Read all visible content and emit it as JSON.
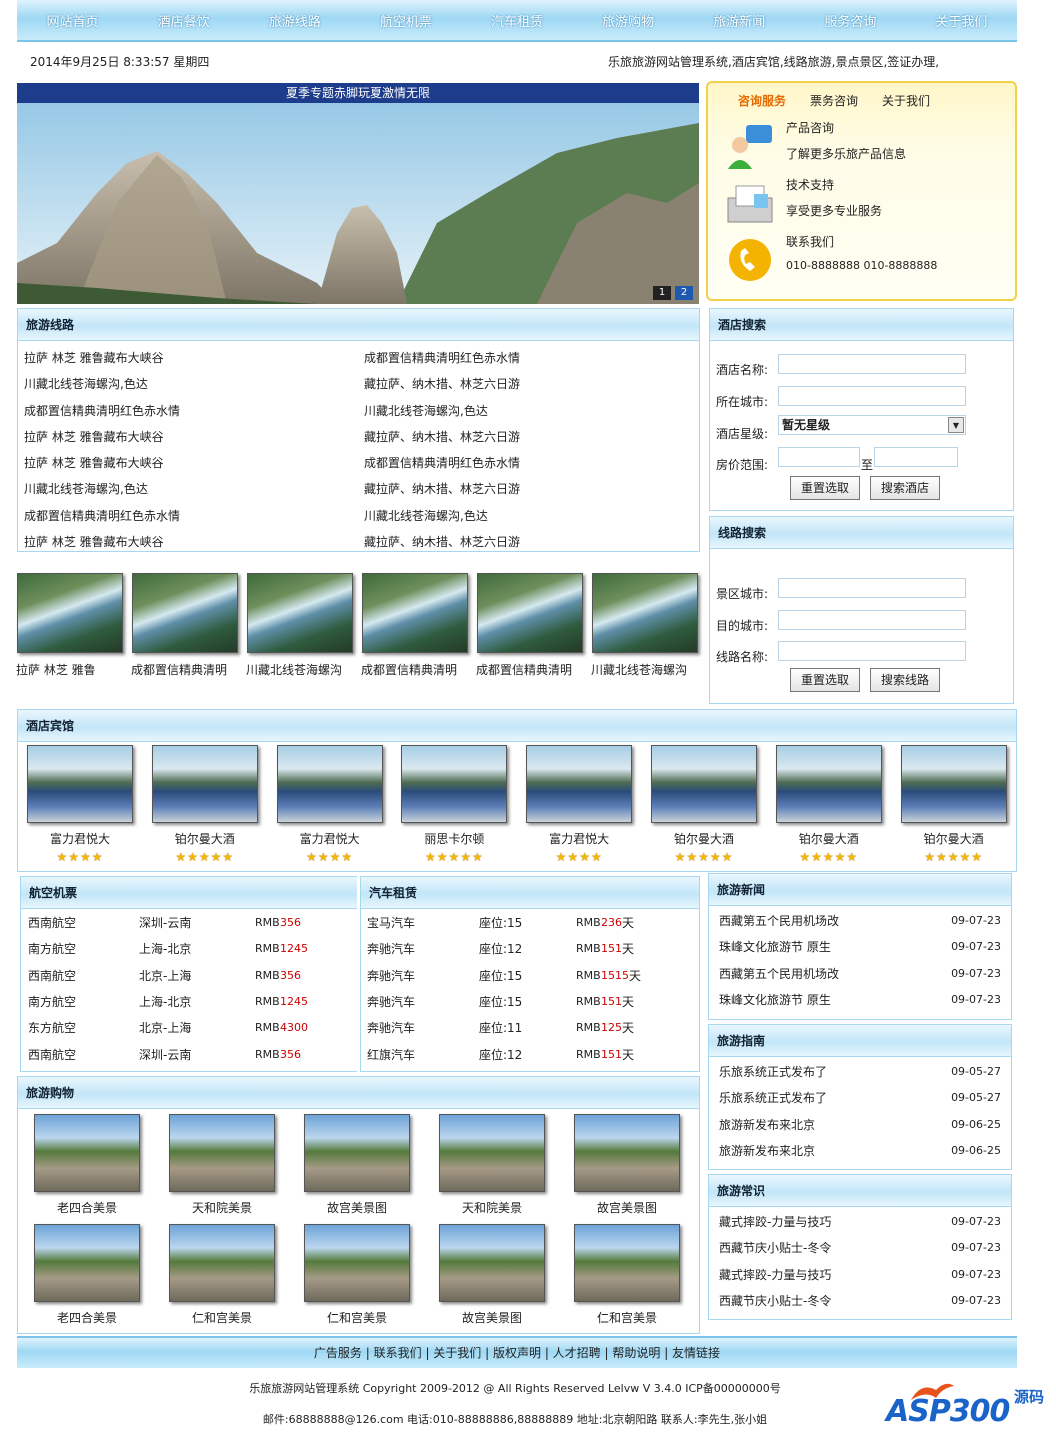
{
  "nav": [
    "网站首页",
    "酒店餐饮",
    "旅游线路",
    "航空机票",
    "汽车租赁",
    "旅游购物",
    "旅游新闻",
    "服务咨询",
    "关于我们"
  ],
  "date_text": "2014年9月25日 8:33:57 星期四",
  "marquee": "乐旅旅游网站管理系统,酒店宾馆,线路旅游,景点景区,签证办理,",
  "banner": {
    "caption": "夏季专题赤脚玩夏激情无限",
    "pages": [
      "1",
      "2"
    ],
    "active_page": "2"
  },
  "consult": {
    "tabs": [
      "咨询服务",
      "票务咨询",
      "关于我们"
    ],
    "items": [
      {
        "title": "产品咨询",
        "desc": "了解更多乐旅产品信息",
        "icon": "chat-person-icon"
      },
      {
        "title": "技术支持",
        "desc": "享受更多专业服务",
        "icon": "document-tray-icon"
      },
      {
        "title": "联系我们",
        "desc": "010-8888888 010-8888888",
        "icon": "phone-icon"
      }
    ]
  },
  "routes": {
    "title": "旅游线路",
    "left": [
      "拉萨 林芝 雅鲁藏布大峡谷",
      "川藏北线苍海螺沟,色达",
      "成都置信精典清明红色赤水情",
      "拉萨 林芝 雅鲁藏布大峡谷",
      "拉萨 林芝 雅鲁藏布大峡谷",
      "川藏北线苍海螺沟,色达",
      "成都置信精典清明红色赤水情",
      "拉萨 林芝 雅鲁藏布大峡谷"
    ],
    "right": [
      "成都置信精典清明红色赤水情",
      "藏拉萨、纳木措、林芝六日游",
      "川藏北线苍海螺沟,色达",
      "藏拉萨、纳木措、林芝六日游",
      "成都置信精典清明红色赤水情",
      "藏拉萨、纳木措、林芝六日游",
      "川藏北线苍海螺沟,色达",
      "藏拉萨、纳木措、林芝六日游"
    ]
  },
  "scenic": [
    "拉萨 林芝 雅鲁",
    "成都置信精典清明",
    "川藏北线苍海螺沟",
    "成都置信精典清明",
    "成都置信精典清明",
    "川藏北线苍海螺沟"
  ],
  "hotel_search": {
    "title": "酒店搜索",
    "labels": [
      "酒店名称:",
      "所在城市:",
      "酒店星级:",
      "房价范围:"
    ],
    "star_value": "暂无星级",
    "range_sep": "至",
    "reset": "重置选取",
    "submit": "搜索酒店"
  },
  "route_search": {
    "title": "线路搜索",
    "labels": [
      "景区城市:",
      "目的城市:",
      "线路名称:"
    ],
    "reset": "重置选取",
    "submit": "搜索线路"
  },
  "hotels": {
    "title": "酒店宾馆",
    "items": [
      {
        "name": "富力君悦大",
        "stars": 4
      },
      {
        "name": "铂尔曼大酒",
        "stars": 5
      },
      {
        "name": "富力君悦大",
        "stars": 4
      },
      {
        "name": "丽思卡尔顿",
        "stars": 5
      },
      {
        "name": "富力君悦大",
        "stars": 4
      },
      {
        "name": "铂尔曼大酒",
        "stars": 5
      },
      {
        "name": "铂尔曼大酒",
        "stars": 5
      },
      {
        "name": "铂尔曼大酒",
        "stars": 5
      }
    ]
  },
  "flights": {
    "title": "航空机票",
    "rows": [
      {
        "airline": "西南航空",
        "route": "深圳-云南",
        "cur": "RMB",
        "price": "356"
      },
      {
        "airline": "南方航空",
        "route": "上海-北京",
        "cur": "RMB",
        "price": "1245"
      },
      {
        "airline": "西南航空",
        "route": "北京-上海",
        "cur": "RMB",
        "price": "356"
      },
      {
        "airline": "南方航空",
        "route": "上海-北京",
        "cur": "RMB",
        "price": "1245"
      },
      {
        "airline": "东方航空",
        "route": "北京-上海",
        "cur": "RMB",
        "price": "4300"
      },
      {
        "airline": "西南航空",
        "route": "深圳-云南",
        "cur": "RMB",
        "price": "356"
      }
    ]
  },
  "cars": {
    "title": "汽车租赁",
    "rows": [
      {
        "name": "宝马汽车",
        "seats": "座位:15",
        "cur": "RMB",
        "price": "236",
        "unit": "天"
      },
      {
        "name": "奔驰汽车",
        "seats": "座位:12",
        "cur": "RMB",
        "price": "151",
        "unit": "天"
      },
      {
        "name": "奔驰汽车",
        "seats": "座位:15",
        "cur": "RMB",
        "price": "1515",
        "unit": "天"
      },
      {
        "name": "奔驰汽车",
        "seats": "座位:15",
        "cur": "RMB",
        "price": "151",
        "unit": "天"
      },
      {
        "name": "奔驰汽车",
        "seats": "座位:11",
        "cur": "RMB",
        "price": "125",
        "unit": "天"
      },
      {
        "name": "红旗汽车",
        "seats": "座位:12",
        "cur": "RMB",
        "price": "151",
        "unit": "天"
      }
    ]
  },
  "shopping": {
    "title": "旅游购物",
    "items": [
      "老四合美景",
      "天和院美景",
      "故宫美景图",
      "天和院美景",
      "故宫美景图",
      "老四合美景",
      "仁和宫美景",
      "仁和宫美景",
      "故宫美景图",
      "仁和宫美景"
    ]
  },
  "news": {
    "title": "旅游新闻",
    "rows": [
      {
        "t": "西藏第五个民用机场改",
        "d": "09-07-23"
      },
      {
        "t": "珠峰文化旅游节 原生",
        "d": "09-07-23"
      },
      {
        "t": "西藏第五个民用机场改",
        "d": "09-07-23"
      },
      {
        "t": "珠峰文化旅游节 原生",
        "d": "09-07-23"
      }
    ]
  },
  "guide": {
    "title": "旅游指南",
    "rows": [
      {
        "t": "乐旅系统正式发布了",
        "d": "09-05-27"
      },
      {
        "t": "乐旅系统正式发布了",
        "d": "09-05-27"
      },
      {
        "t": "旅游新发布来北京",
        "d": "09-06-25"
      },
      {
        "t": "旅游新发布来北京",
        "d": "09-06-25"
      }
    ]
  },
  "tips": {
    "title": "旅游常识",
    "rows": [
      {
        "t": "藏式摔跤-力量与技巧",
        "d": "09-07-23"
      },
      {
        "t": "西藏节庆小贴士-冬令",
        "d": "09-07-23"
      },
      {
        "t": "藏式摔跤-力量与技巧",
        "d": "09-07-23"
      },
      {
        "t": "西藏节庆小贴士-冬令",
        "d": "09-07-23"
      }
    ]
  },
  "footer_links": [
    "广告服务",
    "联系我们",
    "关于我们",
    "版权声明",
    "人才招聘",
    "帮助说明",
    "友情链接"
  ],
  "copyright": "乐旅旅游网站管理系统 Copyright 2009-2012 @ All Rights Reserved Lelvw V 3.4.0 ICP备00000000号",
  "contact": "邮件:68888888@126.com 电话:010-88888886,88888889   地址:北京朝阳路 联系人:李先生,张小姐",
  "logo": {
    "main": "ASP300",
    "sub": "源码"
  }
}
